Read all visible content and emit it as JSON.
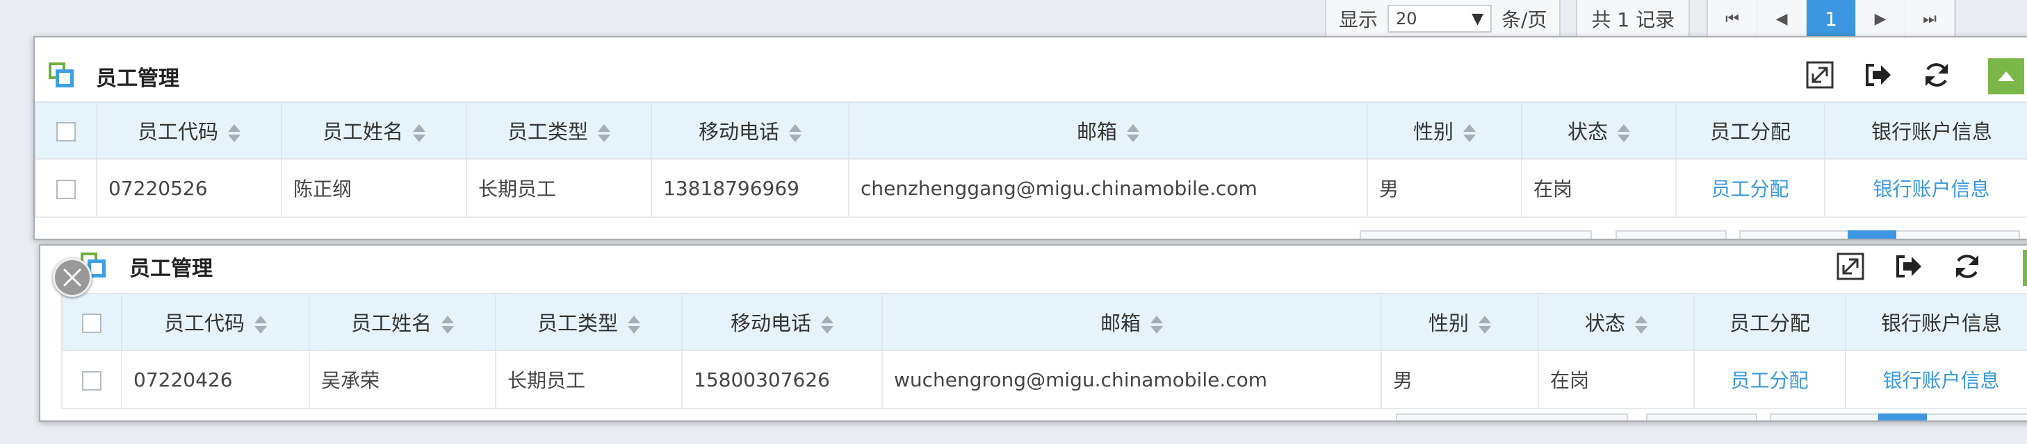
{
  "pager": {
    "show_label": "显示",
    "page_size": "20",
    "per_page_label": "条/页",
    "total_label": "共 1 记录",
    "current_page": "1"
  },
  "panel1": {
    "title": "员工管理",
    "columns": [
      "员工代码",
      "员工姓名",
      "员工类型",
      "移动电话",
      "邮箱",
      "性别",
      "状态",
      "员工分配",
      "银行账户信息"
    ],
    "row": {
      "code": "07220526",
      "name": "陈正纲",
      "type": "长期员工",
      "phone": "13818796969",
      "email": "chenzhenggang@migu.chinamobile.com",
      "gender": "男",
      "status": "在岗",
      "assign": "员工分配",
      "bank": "银行账户信息"
    }
  },
  "panel2": {
    "title": "员工管理",
    "columns": [
      "员工代码",
      "员工姓名",
      "员工类型",
      "移动电话",
      "邮箱",
      "性别",
      "状态",
      "员工分配",
      "银行账户信息"
    ],
    "row": {
      "code": "07220426",
      "name": "吴承荣",
      "type": "长期员工",
      "phone": "15800307626",
      "email": "wuchengrong@migu.chinamobile.com",
      "gender": "男",
      "status": "在岗",
      "assign": "员工分配",
      "bank": "银行账户信息"
    }
  },
  "icons": {
    "expand": "expand-icon",
    "export": "export-icon",
    "refresh": "refresh-icon",
    "collapse": "collapse-icon",
    "close": "close-icon"
  },
  "colors": {
    "accent_blue": "#3c97e0",
    "header_bg": "#e6f3fb",
    "link": "#3a98dc",
    "green": "#7ab648"
  }
}
